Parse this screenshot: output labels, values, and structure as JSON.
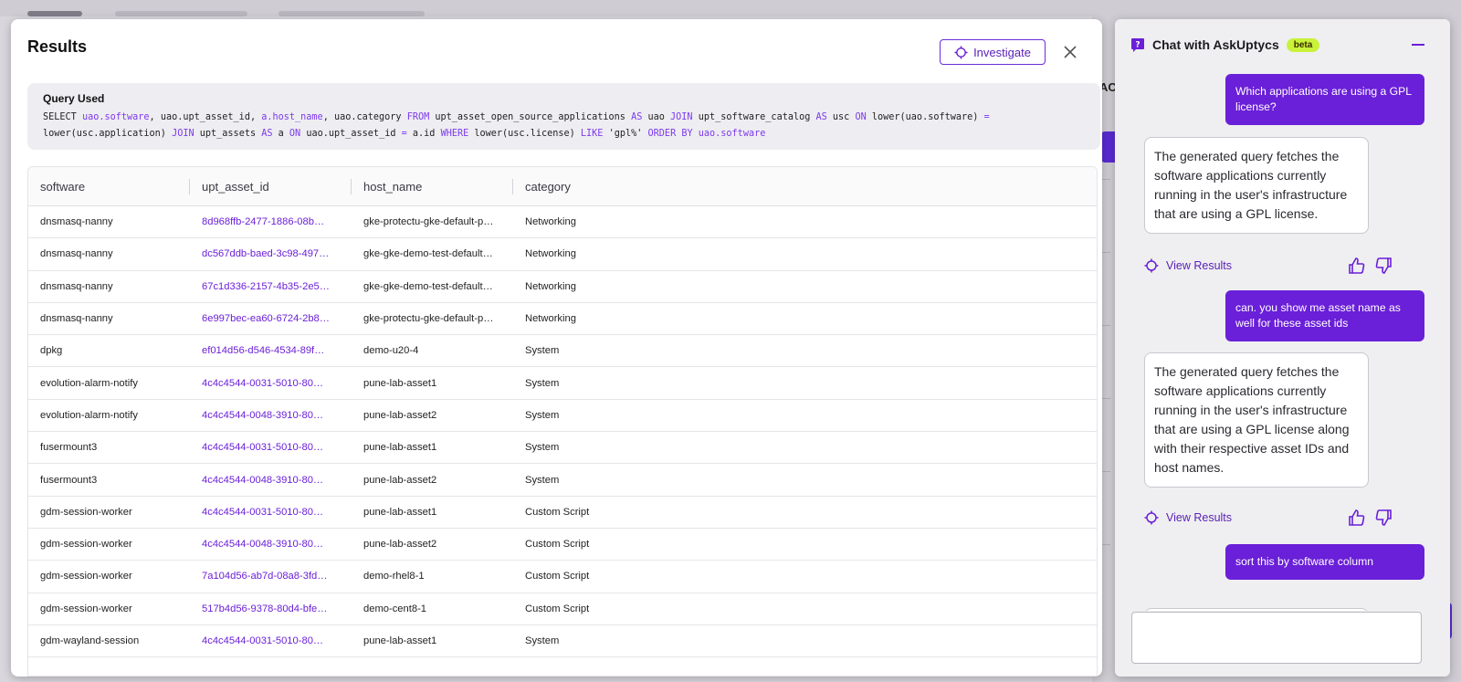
{
  "results": {
    "title": "Results",
    "investigate_label": "Investigate",
    "query_label": "Query Used",
    "query_tokens": [
      {
        "t": "SELECT ",
        "k": false
      },
      {
        "t": "uao.software",
        "k": true
      },
      {
        "t": ", uao.upt_asset_id, ",
        "k": false
      },
      {
        "t": "a.host_name",
        "k": true
      },
      {
        "t": ", uao.category ",
        "k": false
      },
      {
        "t": "FROM",
        "k": true
      },
      {
        "t": " upt_asset_open_source_applications ",
        "k": false
      },
      {
        "t": "AS",
        "k": true
      },
      {
        "t": " uao ",
        "k": false
      },
      {
        "t": "JOIN",
        "k": true
      },
      {
        "t": " upt_software_catalog ",
        "k": false
      },
      {
        "t": "AS",
        "k": true
      },
      {
        "t": " usc ",
        "k": false
      },
      {
        "t": "ON",
        "k": true
      },
      {
        "t": " lower(uao.software) ",
        "k": false
      },
      {
        "t": "=",
        "k": true
      },
      {
        "t": " lower(usc.application) ",
        "k": false
      },
      {
        "t": "JOIN",
        "k": true
      },
      {
        "t": " upt_assets ",
        "k": false
      },
      {
        "t": "AS",
        "k": true
      },
      {
        "t": " a ",
        "k": false
      },
      {
        "t": "ON",
        "k": true
      },
      {
        "t": " uao.upt_asset_id ",
        "k": false
      },
      {
        "t": "=",
        "k": true
      },
      {
        "t": " a.id ",
        "k": false
      },
      {
        "t": "WHERE",
        "k": true
      },
      {
        "t": " lower(usc.license) ",
        "k": false
      },
      {
        "t": "LIKE",
        "k": true
      },
      {
        "t": " 'gpl%' ",
        "k": false
      },
      {
        "t": "ORDER BY",
        "k": true
      },
      {
        "t": " ",
        "k": false
      },
      {
        "t": "uao.software",
        "k": true
      }
    ],
    "columns": [
      "software",
      "upt_asset_id",
      "host_name",
      "category"
    ],
    "rows": [
      [
        "dnsmasq-nanny",
        "8d968ffb-2477-1886-08b…",
        "gke-protectu-gke-default-p…",
        "Networking"
      ],
      [
        "dnsmasq-nanny",
        "dc567ddb-baed-3c98-497…",
        "gke-gke-demo-test-default…",
        "Networking"
      ],
      [
        "dnsmasq-nanny",
        "67c1d336-2157-4b35-2e5…",
        "gke-gke-demo-test-default…",
        "Networking"
      ],
      [
        "dnsmasq-nanny",
        "6e997bec-ea60-6724-2b8…",
        "gke-protectu-gke-default-p…",
        "Networking"
      ],
      [
        "dpkg",
        "ef014d56-d546-4534-89f…",
        "demo-u20-4",
        "System"
      ],
      [
        "evolution-alarm-notify",
        "4c4c4544-0031-5010-80…",
        "pune-lab-asset1",
        "System"
      ],
      [
        "evolution-alarm-notify",
        "4c4c4544-0048-3910-80…",
        "pune-lab-asset2",
        "System"
      ],
      [
        "fusermount3",
        "4c4c4544-0031-5010-80…",
        "pune-lab-asset1",
        "System"
      ],
      [
        "fusermount3",
        "4c4c4544-0048-3910-80…",
        "pune-lab-asset2",
        "System"
      ],
      [
        "gdm-session-worker",
        "4c4c4544-0031-5010-80…",
        "pune-lab-asset1",
        "Custom Script"
      ],
      [
        "gdm-session-worker",
        "4c4c4544-0048-3910-80…",
        "pune-lab-asset2",
        "Custom Script"
      ],
      [
        "gdm-session-worker",
        "7a104d56-ab7d-08a8-3fd…",
        "demo-rhel8-1",
        "Custom Script"
      ],
      [
        "gdm-session-worker",
        "517b4d56-9378-80d4-bfe…",
        "demo-cent8-1",
        "Custom Script"
      ],
      [
        "gdm-wayland-session",
        "4c4c4544-0031-5010-80…",
        "pune-lab-asset1",
        "System"
      ]
    ]
  },
  "chat": {
    "title": "Chat with AskUptycs",
    "badge": "beta",
    "messages": [
      {
        "role": "user",
        "text": "Which applications are using a GPL license?"
      },
      {
        "role": "bot",
        "text": "The generated query fetches the software applications currently running in the user's infrastructure that are using a GPL license.",
        "action": "View Results"
      },
      {
        "role": "user",
        "text": "can. you show me asset name as well for these asset ids"
      },
      {
        "role": "bot",
        "text": "The generated query fetches the software applications currently running in the user's infrastructure that are using a GPL license along with their respective asset IDs and host names.",
        "action": "View Results"
      },
      {
        "role": "user",
        "text": "sort this by software column"
      }
    ],
    "input_value": ""
  },
  "backdrop": {
    "partial_label": "AC"
  },
  "colors": {
    "accent": "#6a1fd8",
    "beta_badge": "#c9f23a"
  }
}
